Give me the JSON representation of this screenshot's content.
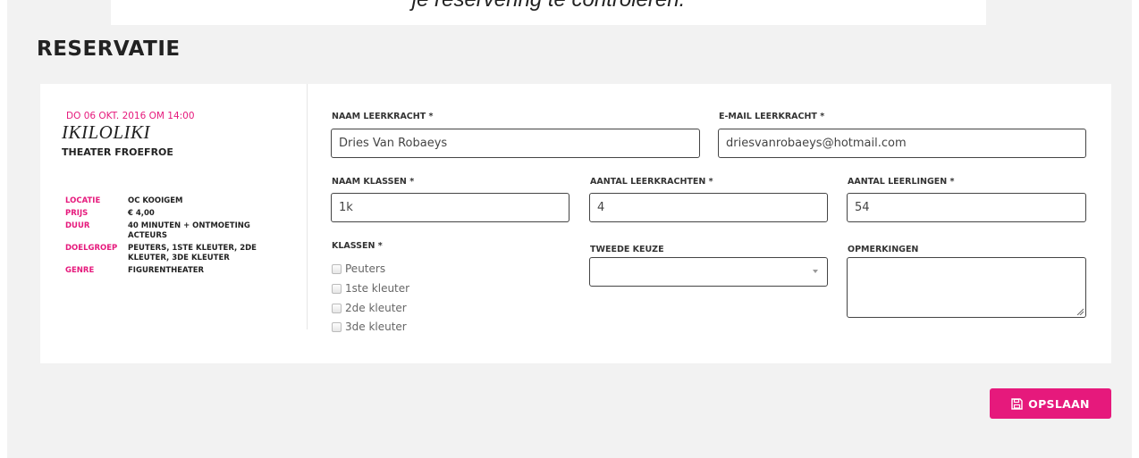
{
  "banner": {
    "text": "je reservering te controleren."
  },
  "section_title": "RESERVATIE",
  "event": {
    "date": "DO 06 OKT. 2016 OM 14:00",
    "title": "IKILOLIKI",
    "company": "THEATER FROEFROE",
    "info": [
      {
        "label": "LOCATIE",
        "value": "OC KOOIGEM"
      },
      {
        "label": "PRIJS",
        "value": "€ 4,00"
      },
      {
        "label": "DUUR",
        "value": "40 MINUTEN + ONTMOETING ACTEURS"
      },
      {
        "label": "DOELGROEP",
        "value": "PEUTERS, 1STE KLEUTER, 2DE KLEUTER, 3DE KLEUTER"
      },
      {
        "label": "GENRE",
        "value": "FIGURENTHEATER"
      }
    ]
  },
  "form": {
    "teacher_name": {
      "label": "NAAM LEERKRACHT *",
      "value": "Dries Van Robaeys"
    },
    "teacher_email": {
      "label": "E-MAIL LEERKRACHT *",
      "value": "driesvanrobaeys@hotmail.com"
    },
    "class_name": {
      "label": "NAAM KLASSEN *",
      "value": "1k"
    },
    "num_teachers": {
      "label": "AANTAL LEERKRACHTEN *",
      "value": "4"
    },
    "num_students": {
      "label": "AANTAL LEERLINGEN *",
      "value": "54"
    },
    "classes": {
      "label": "KLASSEN *",
      "options": [
        "Peuters",
        "1ste kleuter",
        "2de kleuter",
        "3de kleuter"
      ]
    },
    "second_choice": {
      "label": "TWEEDE KEUZE",
      "value": ""
    },
    "remarks": {
      "label": "OPMERKINGEN",
      "value": ""
    }
  },
  "save_button": {
    "label": "OPSLAAN",
    "icon": "floppy-disk-icon"
  },
  "colors": {
    "accent": "#e6197c",
    "background": "#f2f2f2",
    "card": "#ffffff"
  }
}
